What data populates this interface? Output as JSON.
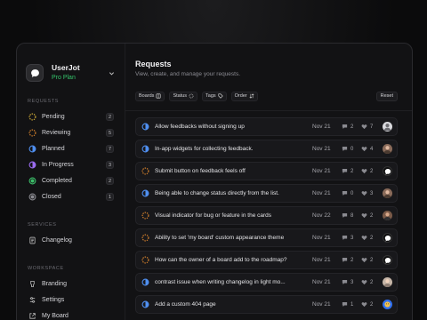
{
  "brand": {
    "name": "UserJot",
    "plan": "Pro Plan"
  },
  "sidebar": {
    "requests_label": "REQUESTS",
    "statuses": [
      {
        "label": "Pending",
        "count": "2",
        "icon": "pending-icon"
      },
      {
        "label": "Reviewing",
        "count": "5",
        "icon": "reviewing-icon"
      },
      {
        "label": "Planned",
        "count": "7",
        "icon": "planned-icon"
      },
      {
        "label": "In Progress",
        "count": "3",
        "icon": "in-progress-icon"
      },
      {
        "label": "Completed",
        "count": "2",
        "icon": "completed-icon"
      },
      {
        "label": "Closed",
        "count": "1",
        "icon": "closed-icon"
      }
    ],
    "services_label": "SERVICES",
    "services": [
      {
        "label": "Changelog",
        "icon": "changelog-icon"
      }
    ],
    "workspace_label": "WORKSPACE",
    "workspace": [
      {
        "label": "Branding",
        "icon": "branding-icon"
      },
      {
        "label": "Settings",
        "icon": "settings-icon"
      },
      {
        "label": "My Board",
        "icon": "external-link-icon"
      }
    ]
  },
  "main": {
    "title": "Requests",
    "subtitle": "View, create, and manage your requests.",
    "filters": [
      {
        "label": "Boards",
        "icon": "board-icon"
      },
      {
        "label": "Status",
        "icon": "status-icon"
      },
      {
        "label": "Tags",
        "icon": "tag-icon"
      },
      {
        "label": "Order",
        "icon": "sort-icon"
      }
    ],
    "reset_label": "Reset"
  },
  "requests": [
    {
      "status": "planned",
      "title": "Allow feedbacks without signing up",
      "date": "Nov 21",
      "comments": "2",
      "votes": "7",
      "avatar": "a1"
    },
    {
      "status": "planned",
      "title": "In-app widgets for collecting feedback.",
      "date": "Nov 21",
      "comments": "0",
      "votes": "4",
      "avatar": "a2"
    },
    {
      "status": "reviewing",
      "title": "Submit button on feedback feels off",
      "date": "Nov 21",
      "comments": "2",
      "votes": "2",
      "avatar": "a3"
    },
    {
      "status": "planned",
      "title": "Being able to change status directly from the list.",
      "date": "Nov 21",
      "comments": "0",
      "votes": "3",
      "avatar": "a2"
    },
    {
      "status": "reviewing",
      "title": "Visual indicator for bug or feature in the cards",
      "date": "Nov 22",
      "comments": "8",
      "votes": "2",
      "avatar": "a4"
    },
    {
      "status": "reviewing",
      "title": "Ability to set 'my board' custom appearance theme",
      "date": "Nov 21",
      "comments": "3",
      "votes": "2",
      "avatar": "a3"
    },
    {
      "status": "reviewing",
      "title": "How can the owner of a board add to the roadmap?",
      "date": "Nov 21",
      "comments": "2",
      "votes": "2",
      "avatar": "a3"
    },
    {
      "status": "planned",
      "title": "contrast issue when writing changelog in light mo...",
      "date": "Nov 21",
      "comments": "3",
      "votes": "2",
      "avatar": "a5"
    },
    {
      "status": "planned",
      "title": "Add a custom 404 page",
      "date": "Nov 21",
      "comments": "1",
      "votes": "2",
      "avatar": "a6"
    }
  ],
  "colors": {
    "pending": "#e0b93a",
    "reviewing": "#e58a2e",
    "planned": "#4f8ff0",
    "in_progress": "#9a6cf0",
    "completed": "#3cbf6a",
    "closed": "#8a8a90",
    "plan": "#35c46b"
  }
}
